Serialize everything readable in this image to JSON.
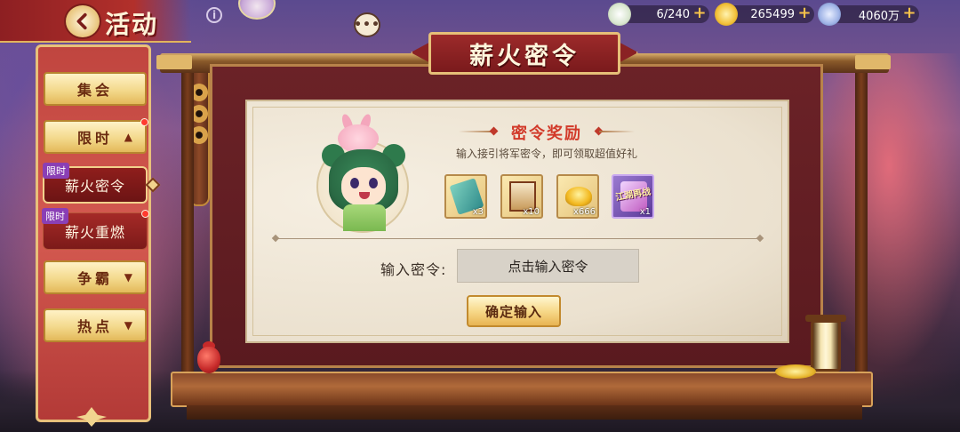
{
  "header": {
    "title": "活动",
    "back_icon": "back-arrow-icon",
    "info_icon": "info-icon",
    "chat_icon": "chat-bubble-icon"
  },
  "currencies": [
    {
      "name": "stamina",
      "icon": "tea-bun-icon",
      "value": "6/240"
    },
    {
      "name": "gold",
      "icon": "gold-ingot-icon",
      "value": "265499"
    },
    {
      "name": "silver",
      "icon": "coin-icon",
      "value": "4060万"
    }
  ],
  "sidebar": {
    "items": [
      {
        "label": "集会",
        "type": "category"
      },
      {
        "label": "限时",
        "type": "category",
        "expanded": true,
        "badge": true
      },
      {
        "label": "薪火密令",
        "type": "sub",
        "tag": "限时",
        "active": true
      },
      {
        "label": "薪火重燃",
        "type": "sub",
        "tag": "限时",
        "badge": true
      },
      {
        "label": "争霸",
        "type": "category"
      },
      {
        "label": "热点",
        "type": "category"
      }
    ]
  },
  "panel": {
    "title": "薪火密令",
    "rewards_title": "密令奖励",
    "subtitle": "输入接引将军密令，即可领取超值好礼",
    "rewards": [
      {
        "icon": "jade-scroll-icon",
        "count": "x3"
      },
      {
        "icon": "scroll-painting-icon",
        "count": "x10"
      },
      {
        "icon": "gold-ingot-icon",
        "count": "x666"
      },
      {
        "icon": "event-banner-icon",
        "count": "x1",
        "banner_text": "江湖再战"
      }
    ],
    "input_label": "输入密令:",
    "input_placeholder": "点击输入密令",
    "confirm_label": "确定输入"
  },
  "colors": {
    "accent_red": "#b2302b",
    "gold": "#e6bf78",
    "badge_red": "#ff3b2f",
    "tag_purple": "#8a3fb5"
  }
}
